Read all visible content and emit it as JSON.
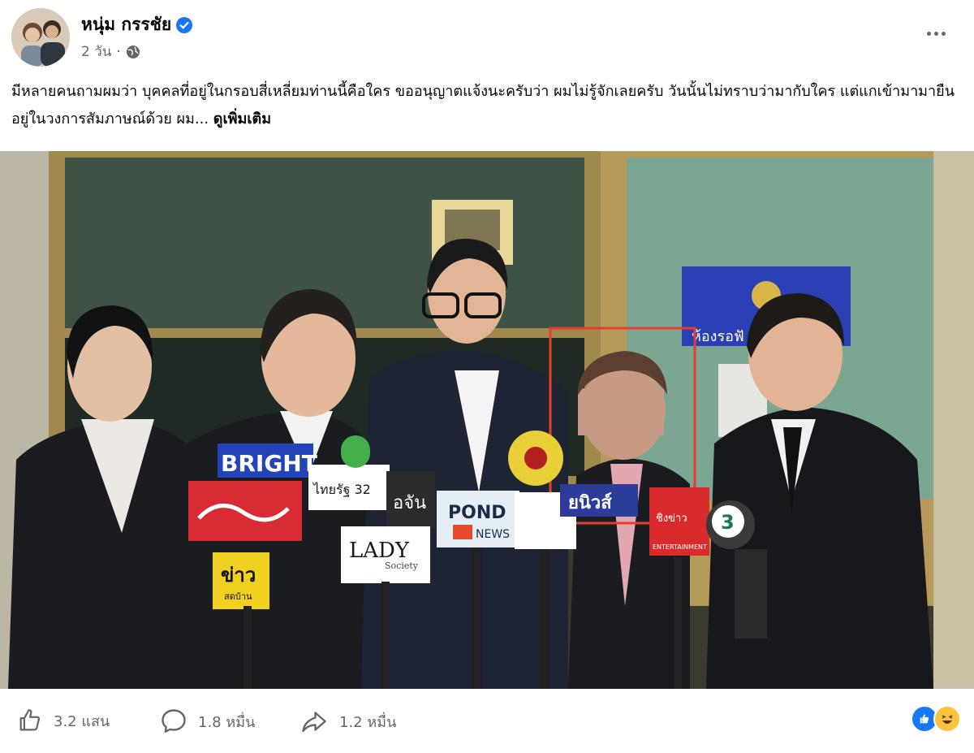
{
  "post": {
    "author": "หนุ่ม กรรชัย",
    "timestamp": "2 วัน",
    "audience_icon": "globe-icon",
    "text_main": "มีหลายคนถามผมว่า บุคคลที่อยู่ในกรอบสี่เหลี่ยมท่านนี้คือใคร ขออนุญาตแจ้งนะครับว่า ผมไม่รู้จักเลยครับ วันนั้นไม่ทราบว่ามากับใคร แต่แกเข้ามามายืนอยู่ในวงการสัมภาษณ์ด้วย ผม...",
    "see_more": "ดูเพิ่มเติม"
  },
  "photo": {
    "sign_text": "ห้องรอฟั",
    "mic_labels": {
      "bright": "BRIGHT",
      "ch32": "ไทยรัฐ 32",
      "amarin": "อจัน",
      "pond": "POND",
      "news": "NEWS",
      "lady": "LADY",
      "lady_sub": "Society",
      "khao": "ข่าว",
      "khao_sub": "สดบ้าน",
      "ynews": "ยนิวส์",
      "ch3": "3",
      "ent": "ENTERTAINMENT",
      "sanook": "ชิงข่าว"
    },
    "colors": {
      "highlight_box": "#e1402f",
      "wall_green": "#7aa692",
      "suit": "#1b1c20"
    }
  },
  "actions": {
    "like_count": "3.2 แสน",
    "comment_count": "1.8 หมื่น",
    "share_count": "1.2 หมื่น",
    "like_icon": "thumbs-up-icon",
    "comment_icon": "comment-bubble-icon",
    "share_icon": "share-arrow-icon"
  },
  "reactions": [
    "like-reaction-icon",
    "haha-reaction-icon"
  ],
  "colors": {
    "facebook_blue": "#1877f2",
    "secondary_text": "#65676b"
  }
}
